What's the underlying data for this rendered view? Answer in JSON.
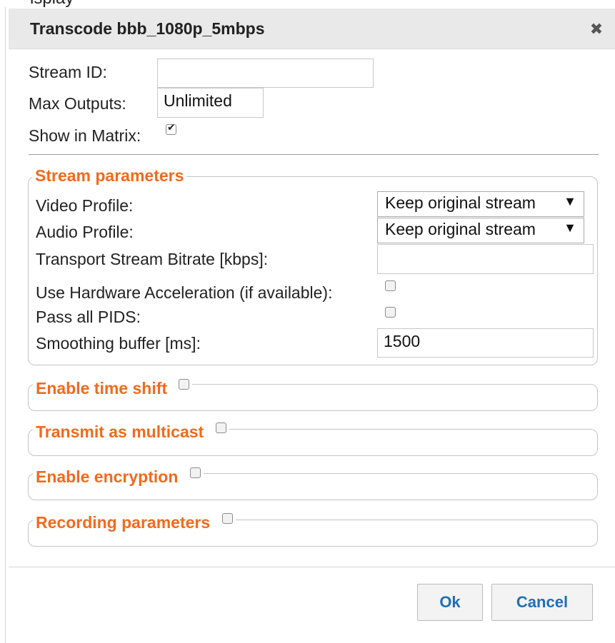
{
  "page_fragment": "isplay",
  "dialog": {
    "title": "Transcode bbb_1080p_5mbps",
    "close_glyph": "✖"
  },
  "general": {
    "stream_id": {
      "label": "Stream ID:",
      "value": ""
    },
    "max_outputs": {
      "label": "Max Outputs:",
      "value": "Unlimited"
    },
    "show_in_matrix": {
      "label": "Show in Matrix:",
      "checked": true
    }
  },
  "stream_parameters": {
    "legend": "Stream parameters",
    "video_profile": {
      "label": "Video Profile:",
      "selected": "Keep original stream",
      "arrow": "▼"
    },
    "audio_profile": {
      "label": "Audio Profile:",
      "selected": "Keep original stream",
      "arrow": "▼"
    },
    "ts_bitrate": {
      "label": "Transport Stream Bitrate [kbps]:",
      "value": ""
    },
    "hw_accel": {
      "label": "Use Hardware Acceleration (if available):",
      "checked": false
    },
    "pass_pids": {
      "label": "Pass all PIDS:",
      "checked": false
    },
    "smoothing_buffer": {
      "label": "Smoothing buffer [ms]:",
      "value": "1500"
    }
  },
  "sections": [
    {
      "legend": "Enable time shift",
      "checked": false
    },
    {
      "legend": "Transmit as multicast",
      "checked": false
    },
    {
      "legend": "Enable encryption",
      "checked": false
    },
    {
      "legend": "Recording parameters",
      "checked": false
    }
  ],
  "footer": {
    "ok_label": "Ok",
    "cancel_label": "Cancel"
  },
  "colors": {
    "accent": "#f26a1b",
    "button_text": "#1f6fb8",
    "titlebar_bg": "#e9e9e9"
  }
}
